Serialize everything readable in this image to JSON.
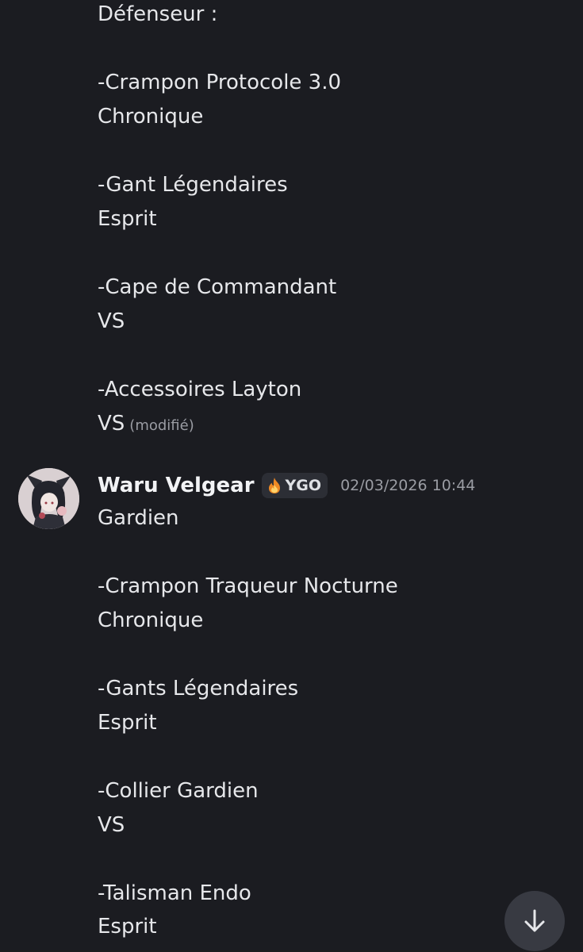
{
  "previous_message": {
    "lines": [
      "Défenseur :",
      "-Crampon Protocole 3.0",
      "Chronique",
      "-Gant Légendaires",
      "Esprit",
      "-Cape de Commandant",
      "VS",
      "-Accessoires Layton",
      "VS"
    ],
    "edited_label": "(modifié)"
  },
  "message": {
    "author": "Waru Velgear",
    "tag_icon": "flame-icon",
    "tag": "YGO",
    "timestamp": "02/03/2026 10:44",
    "lines": [
      "Gardien",
      "-Crampon Traqueur Nocturne",
      "Chronique",
      "-Gants Légendaires",
      "Esprit",
      "-Collier Gardien",
      "VS",
      "-Talisman Endo",
      "Esprit"
    ]
  },
  "scroll_button_icon": "arrow-down-icon",
  "colors": {
    "background": "#1b1c21",
    "text": "#e6e7ea",
    "muted": "#9a9ca3",
    "tag_background": "#2c2e35",
    "scroll_button": "#383a42"
  }
}
